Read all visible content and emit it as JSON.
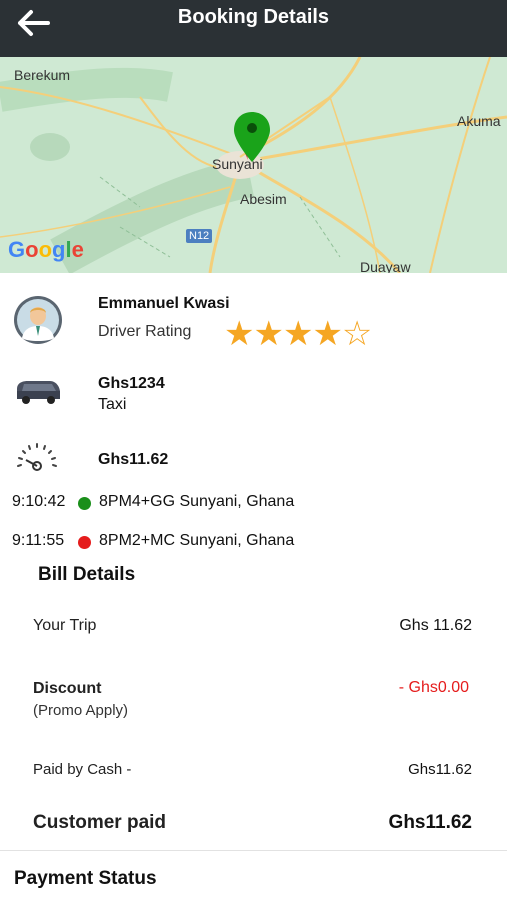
{
  "header": {
    "title": "Booking Details"
  },
  "map": {
    "labels": {
      "berekum": "Berekum",
      "akuma": "Akuma",
      "sunyani": "Sunyani",
      "abesim": "Abesim",
      "road": "N12",
      "duayaw": "Duayaw"
    },
    "logo": "Google"
  },
  "driver": {
    "name": "Emmanuel Kwasi",
    "rating_label": "Driver Rating",
    "rating": 4,
    "rating_max": 5,
    "stars": "★★★★☆"
  },
  "vehicle": {
    "plate": "Ghs1234",
    "type": "Taxi"
  },
  "fare": {
    "amount": "Ghs11.62"
  },
  "trip": {
    "pickup": {
      "time": "9:10:42",
      "address": "8PM4+GG Sunyani, Ghana",
      "color": "#1a8f1a"
    },
    "dropoff": {
      "time": "9:11:55",
      "address": "8PM2+MC Sunyani, Ghana",
      "color": "#e51c1c"
    }
  },
  "bill": {
    "title": "Bill Details",
    "your_trip_label": "Your Trip",
    "your_trip_value": "Ghs 11.62",
    "discount_label": "Discount",
    "discount_sub": "(Promo Apply)",
    "discount_value": "- Ghs0.00",
    "paid_by_label": "Paid by Cash -",
    "paid_by_value": "Ghs11.62",
    "customer_paid_label": "Customer paid",
    "customer_paid_value": "Ghs11.62"
  },
  "payment": {
    "title": "Payment Status"
  },
  "colors": {
    "header_bg": "#2b3135",
    "star": "#f5a623",
    "discount": "#e51c1c",
    "pin_green": "#1aa31a"
  }
}
